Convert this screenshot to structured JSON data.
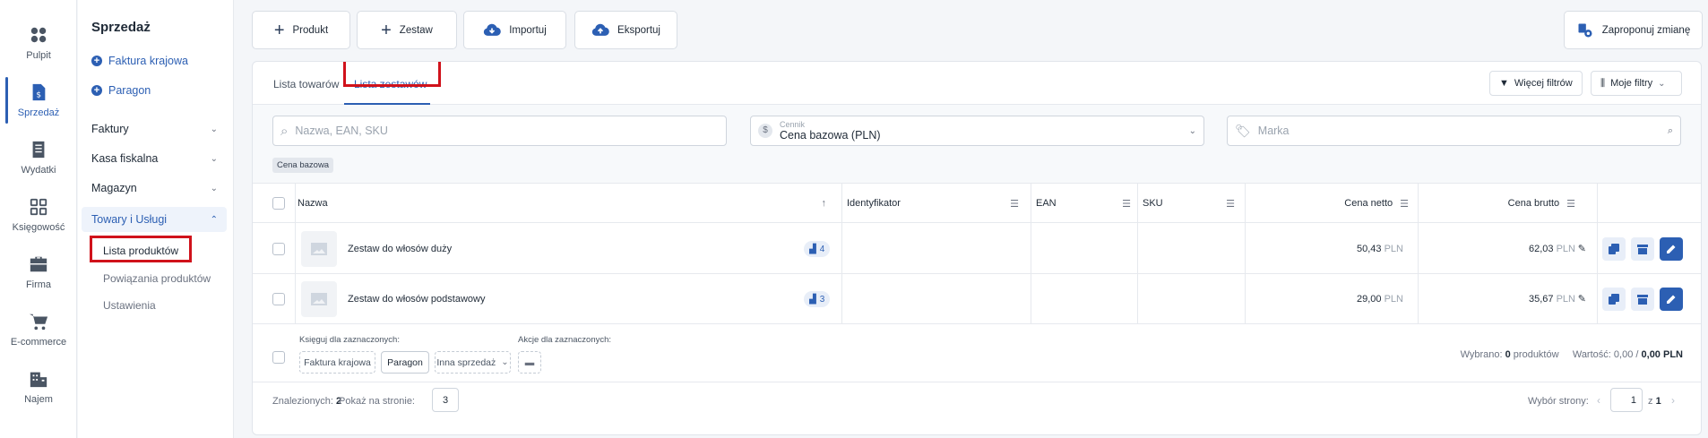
{
  "rail": [
    {
      "label": "Pulpit",
      "icon": "dashboard-icon"
    },
    {
      "label": "Sprzedaż",
      "icon": "sales-document-icon",
      "active": true
    },
    {
      "label": "Wydatki",
      "icon": "expenses-document-icon"
    },
    {
      "label": "Księgowość",
      "icon": "accounting-grid-icon"
    },
    {
      "label": "Firma",
      "icon": "briefcase-icon"
    },
    {
      "label": "E-commerce",
      "icon": "cart-icon"
    },
    {
      "label": "Najem",
      "icon": "building-icon"
    }
  ],
  "subnav": {
    "title": "Sprzedaż",
    "quick_links": [
      "Faktura krajowa",
      "Paragon"
    ],
    "groups": [
      "Faktury",
      "Kasa fiskalna",
      "Magazyn",
      "Towary i Usługi"
    ],
    "sub_items": [
      "Lista produktów",
      "Powiązania produktów",
      "Ustawienia"
    ]
  },
  "toolbar": {
    "produkt": "Produkt",
    "zestaw": "Zestaw",
    "importuj": "Importuj",
    "eksportuj": "Eksportuj",
    "suggest": "Zaproponuj zmianę"
  },
  "tabs": {
    "goods": "Lista towarów",
    "sets": "Lista zestawów",
    "more_filters": "Więcej filtrów",
    "my_filters": "Moje filtry"
  },
  "filters": {
    "search_placeholder": "Nazwa, EAN, SKU",
    "pricelist_label": "Cennik",
    "pricelist_value": "Cena bazowa (PLN)",
    "brand_placeholder": "Marka",
    "chip": "Cena bazowa"
  },
  "table": {
    "headers": {
      "name": "Nazwa",
      "identifier": "Identyfikator",
      "ean": "EAN",
      "sku": "SKU",
      "net": "Cena netto",
      "gross": "Cena brutto"
    },
    "rows": [
      {
        "name": "Zestaw do włosów duży",
        "count": "4",
        "net": "50,43",
        "gross": "62,03",
        "currency": "PLN"
      },
      {
        "name": "Zestaw do włosów podstawowy",
        "count": "3",
        "net": "29,00",
        "gross": "35,67",
        "currency": "PLN"
      }
    ]
  },
  "bulk": {
    "book_label": "Księguj dla zaznaczonych:",
    "actions_label": "Akcje dla zaznaczonych:",
    "invoice_btn": "Faktura krajowa",
    "receipt_btn": "Paragon",
    "other_btn": "Inna sprzedaż",
    "selected_prefix": "Wybrano:",
    "selected_count": "0",
    "selected_suffix": "produktów",
    "value_prefix": "Wartość:",
    "value_a": "0,00",
    "value_sep": "/",
    "value_b": "0,00",
    "value_currency": "PLN"
  },
  "footer": {
    "found_label": "Znalezionych:",
    "found_count": "2",
    "per_page_label": "Pokaż na stronie:",
    "per_page_value": "3",
    "page_select_label": "Wybór strony:",
    "page_value": "1",
    "of_label": "z",
    "total_pages": "1"
  },
  "colors": {
    "accent": "#2c5fb3",
    "highlight": "#d0121b"
  }
}
